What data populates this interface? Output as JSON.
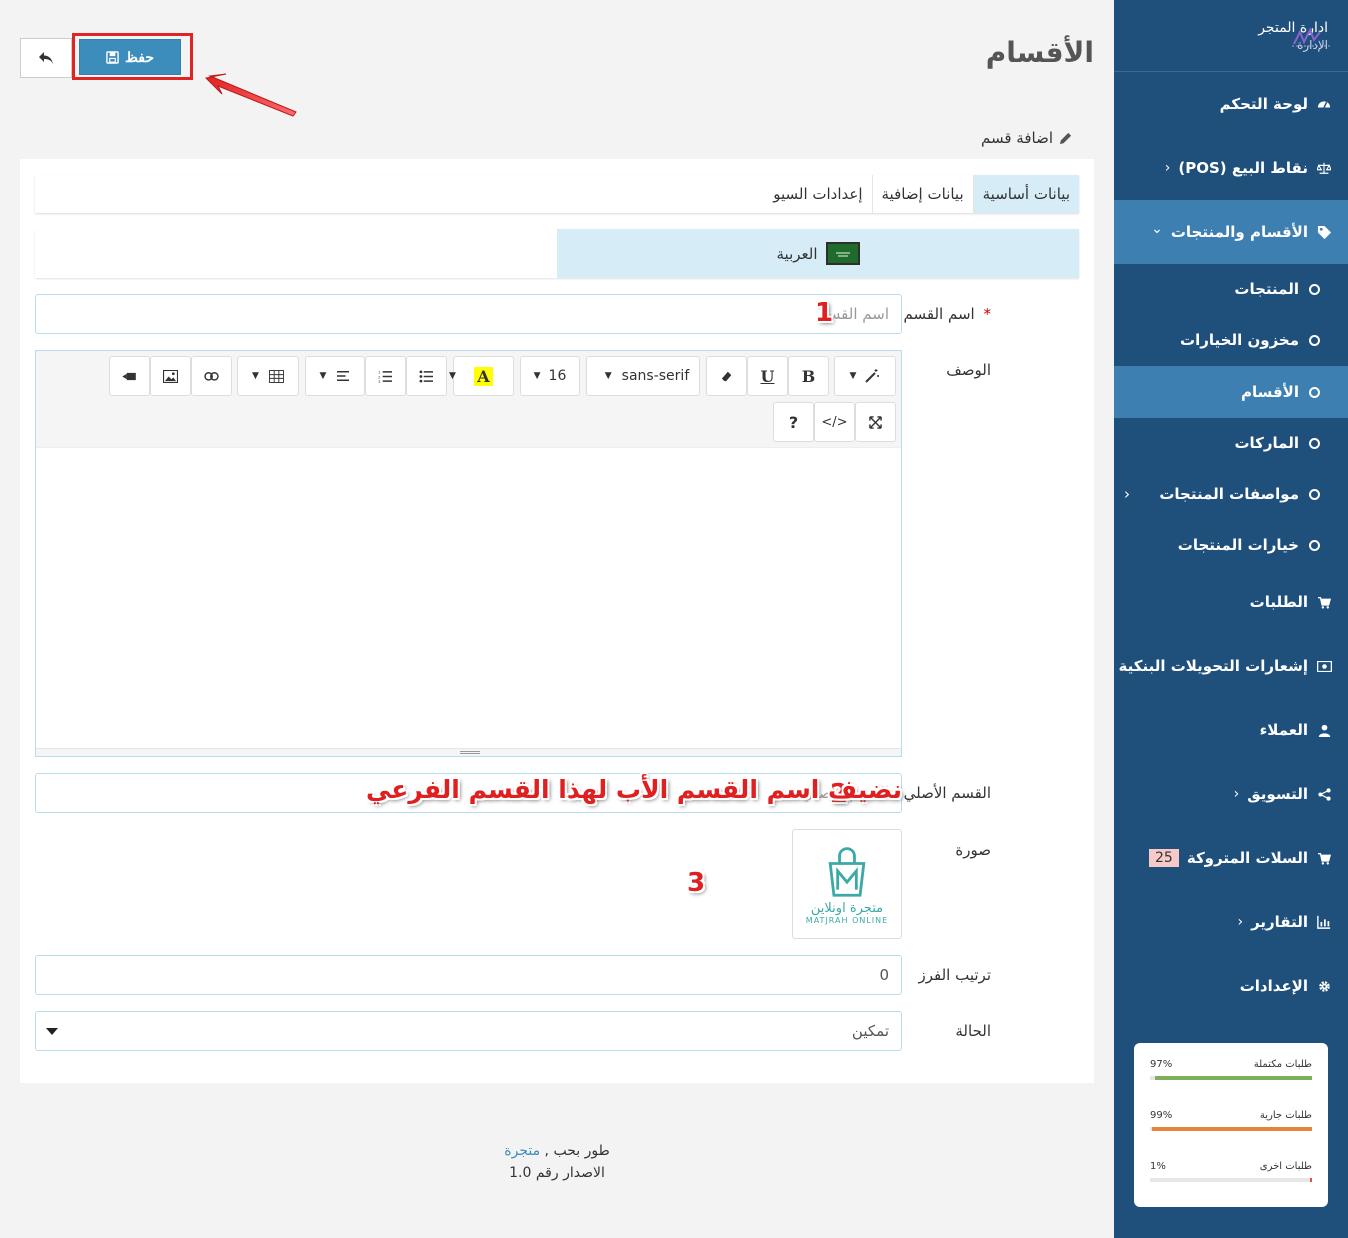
{
  "sidebar": {
    "brand_title": "ادارة المتجر",
    "brand_sub": "الإدارة",
    "items": [
      {
        "label": "لوحة التحكم",
        "icon": "dashboard-icon"
      },
      {
        "label": "نقاط البيع (POS)",
        "icon": "balance-scale-icon",
        "caret": "‹"
      },
      {
        "label": "الأقسام والمنتجات",
        "icon": "tags-icon",
        "caret": "⌄"
      },
      {
        "label": "الطلبات",
        "icon": "cart-icon"
      },
      {
        "label": "إشعارات التحويلات البنكية",
        "icon": "money-icon"
      },
      {
        "label": "العملاء",
        "icon": "user-icon"
      },
      {
        "label": "التسويق",
        "icon": "share-icon",
        "caret": "‹"
      },
      {
        "label": "السلات المتروكة",
        "icon": "cart-icon",
        "badge": "25"
      },
      {
        "label": "التقارير",
        "icon": "bar-chart-icon",
        "caret": "‹"
      },
      {
        "label": "الإعدادات",
        "icon": "gear-icon"
      }
    ],
    "sub_items": [
      {
        "label": "المنتجات"
      },
      {
        "label": "مخزون الخيارات"
      },
      {
        "label": "الأقسام"
      },
      {
        "label": "الماركات"
      },
      {
        "label": "مواصفات المنتجات",
        "caret": "‹"
      },
      {
        "label": "خيارات المنتجات"
      }
    ],
    "stats": [
      {
        "label": "طلبات مكتملة",
        "value": "97%",
        "fraction": 0.97,
        "color": "#7db05b"
      },
      {
        "label": "طلبات جارية",
        "value": "99%",
        "fraction": 0.99,
        "color": "#e8843a"
      },
      {
        "label": "طلبات اخرى",
        "value": "1%",
        "fraction": 0.01,
        "color": "#d9534f"
      }
    ]
  },
  "header": {
    "title": "الأقسام",
    "save_label": "حفظ",
    "back_icon": "reply-icon"
  },
  "panel": {
    "heading": "اضافة قسم",
    "tabs": [
      "بيانات أساسية",
      "بيانات إضافية",
      "إعدادات السيو"
    ],
    "language": "العربية"
  },
  "form": {
    "name_label": "اسم القسم",
    "name_required": "*",
    "name_placeholder": "اسم القسم",
    "description_label": "الوصف",
    "parent_label": "القسم الأصلي",
    "parent_placeholder": "القسم الأصلي",
    "image_label": "صورة",
    "image_logo_ar": "متجرة اونلاين",
    "image_logo_en": "MATJRAH ONLINE",
    "sort_label": "ترتيب الفرز",
    "sort_value": "0",
    "status_label": "الحالة",
    "status_value": "تمكين"
  },
  "editor": {
    "font_name": "sans-serif",
    "font_size": "16",
    "bold": "B",
    "underline": "U",
    "color_letter": "A",
    "help": "?",
    "code": "</>"
  },
  "annotations": {
    "n1": "1",
    "n2": "2",
    "n3": "3",
    "note": "نضيف اسم القسم الأب لهذا القسم الفرعي"
  },
  "footer": {
    "line1_prefix": "طور بحب ,",
    "line1_link": "متجرة",
    "line2": "الاصدار رقم 1.0"
  },
  "colors": {
    "sidebar": "#1f4f7b",
    "active": "#3c7fb0",
    "primary": "#3c8dbc",
    "annotation": "#e02020"
  }
}
